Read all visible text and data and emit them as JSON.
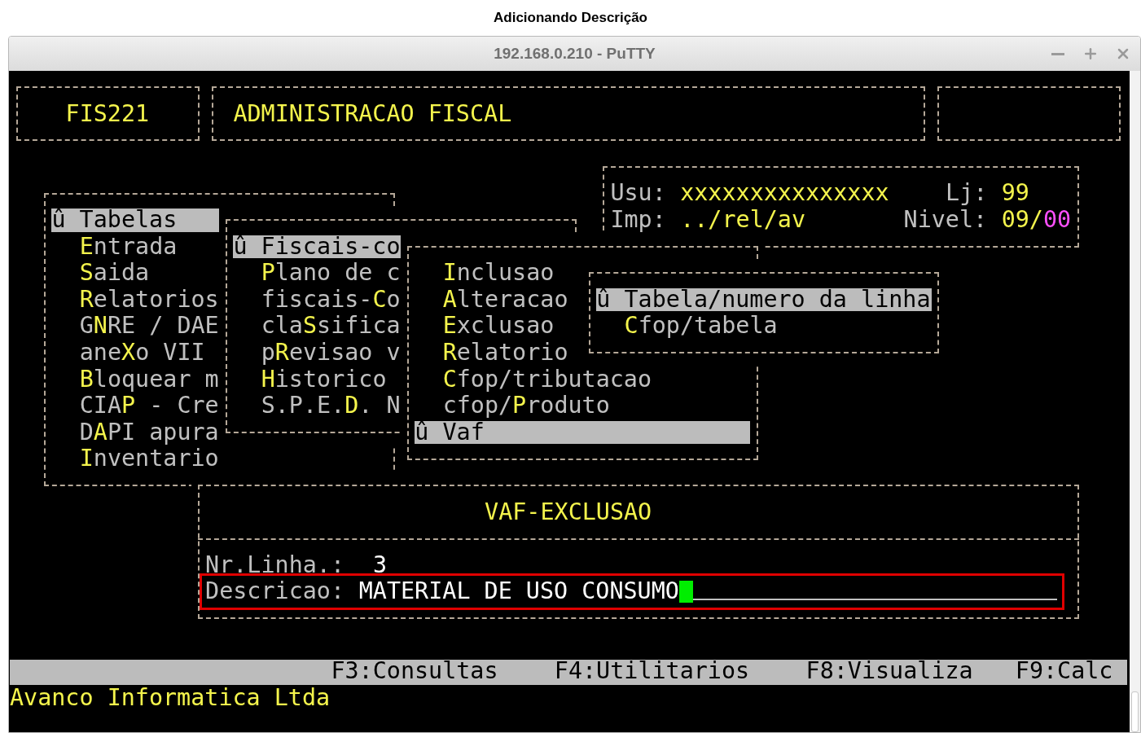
{
  "page_title": "Adicionando Descrição",
  "window": {
    "title": "192.168.0.210 - PuTTY"
  },
  "terminal": {
    "header": {
      "program_code": "FIS221",
      "program_title": "ADMINISTRACAO FISCAL"
    },
    "session": {
      "user_label": "Usu:",
      "user_value": "xxxxxxxxxxxxxxx",
      "store_label": "Lj:",
      "store_value": "99",
      "printer_label": "Imp:",
      "printer_value": "../rel/av",
      "level_label": "Nivel:",
      "level_value": "09/**00**"
    },
    "menus": [
      {
        "items": [
          {
            "label": "û Tabelas",
            "selected": true
          },
          {
            "label": "**E**ntrada",
            "selected": false
          },
          {
            "label": "**S**aida",
            "selected": false
          },
          {
            "label": "**R**elatorios",
            "selected": false
          },
          {
            "label": "G**N**RE / DAE",
            "selected": false
          },
          {
            "label": "ane**X**o VII",
            "selected": false
          },
          {
            "label": "**B**loquear m",
            "selected": false
          },
          {
            "label": "CIA**P** - Cre",
            "selected": false
          },
          {
            "label": "D**A**PI apura",
            "selected": false
          },
          {
            "label": "**I**nventario",
            "selected": false
          }
        ]
      },
      {
        "items": [
          {
            "label": "û Fiscais-co",
            "selected": true
          },
          {
            "label": "**P**lano de c",
            "selected": false
          },
          {
            "label": "fiscais-**C**o",
            "selected": false
          },
          {
            "label": "cla**S**sifica",
            "selected": false
          },
          {
            "label": "p**R**evisao v",
            "selected": false
          },
          {
            "label": "**H**istorico",
            "selected": false
          },
          {
            "label": "S.P.E.**D**. N",
            "selected": false
          }
        ]
      },
      {
        "items": [
          {
            "label": "**I**nclusao",
            "selected": false
          },
          {
            "label": "**A**lteracao",
            "selected": false
          },
          {
            "label": "**E**xclusao",
            "selected": false
          },
          {
            "label": "**R**elatorio",
            "selected": false
          },
          {
            "label": "**C**fop/tributacao",
            "selected": false
          },
          {
            "label": "cfop/**P**roduto",
            "selected": false
          },
          {
            "label": "û Vaf",
            "selected": true
          }
        ]
      },
      {
        "items": [
          {
            "label": "û Tabela/numero da linha",
            "selected": true
          },
          {
            "label": "**C**fop/tabela",
            "selected": false
          }
        ]
      }
    ],
    "dialog": {
      "title": "VAF-EXCLUSAO",
      "fields": [
        {
          "label": "Nr.Linha.:",
          "value": "3",
          "focused": false
        },
        {
          "label": "Descricao:",
          "value": "MATERIAL DE USO CONSUMO",
          "focused": true
        }
      ]
    },
    "function_keys": [
      "F3:Consultas",
      "F4:Utilitarios",
      "F8:Visualiza",
      "F9:Calc"
    ],
    "footer": "Avanco Informatica Ltda"
  }
}
